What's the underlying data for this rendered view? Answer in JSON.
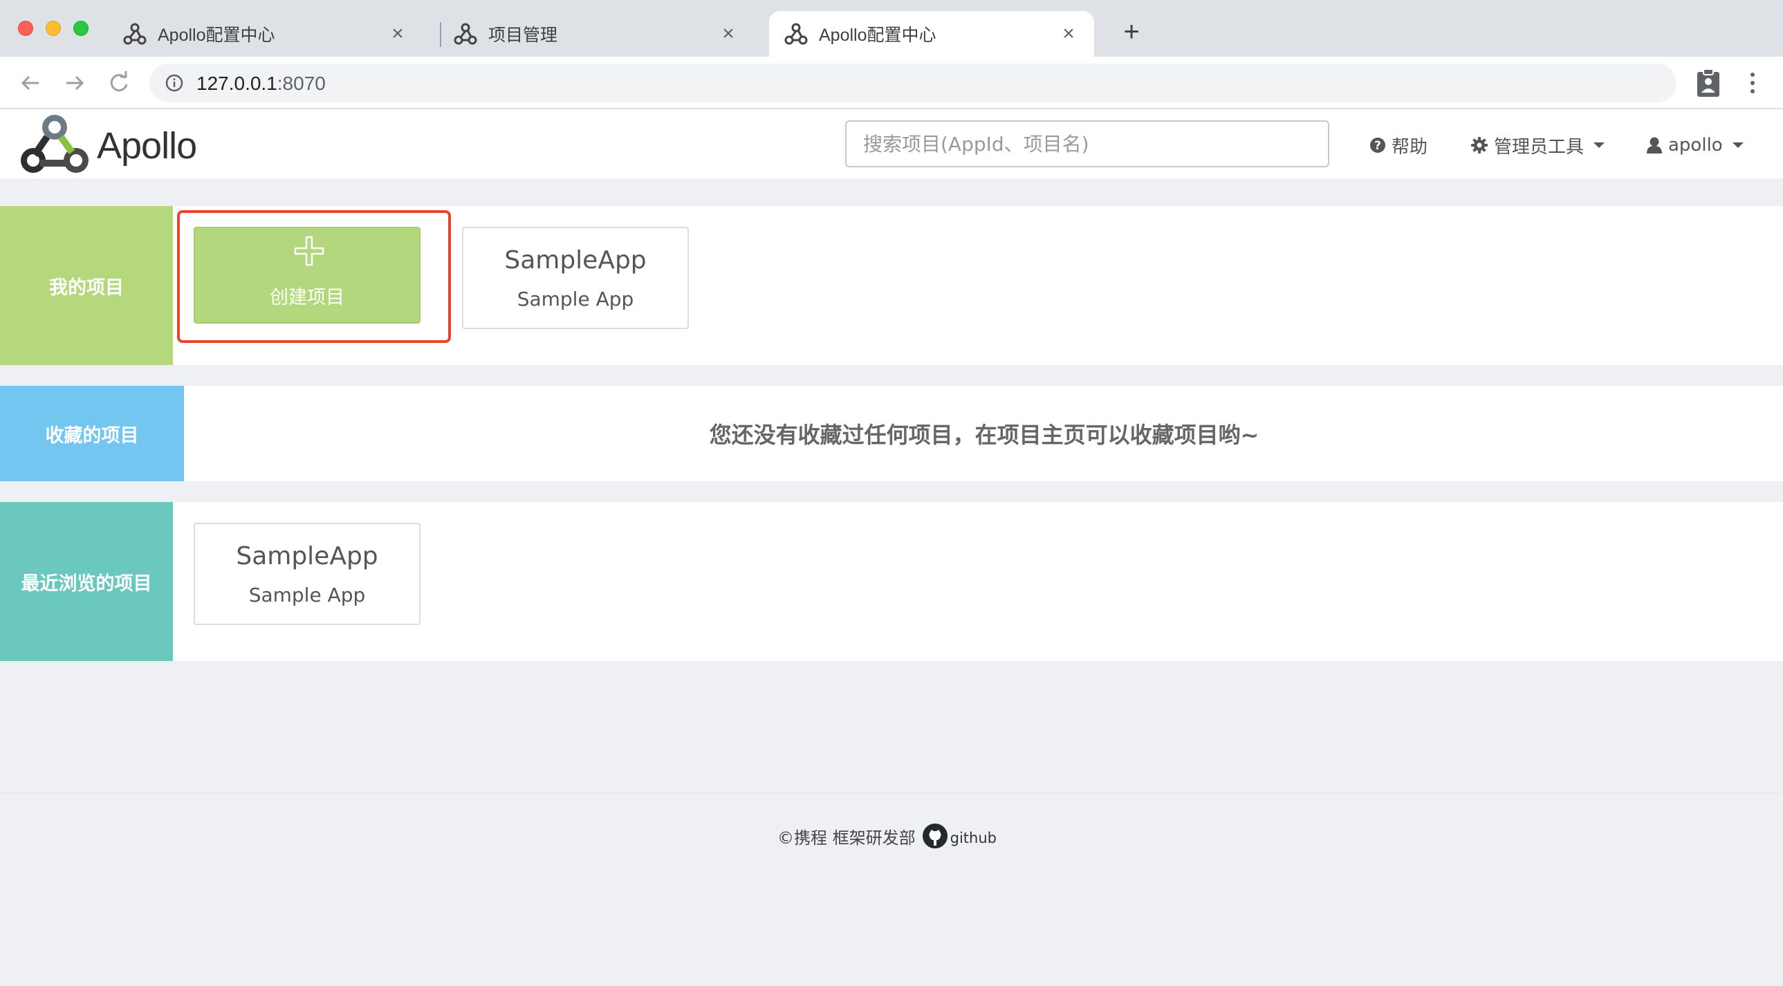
{
  "browser": {
    "tabs": [
      {
        "title": "Apollo配置中心",
        "active": false
      },
      {
        "title": "项目管理",
        "active": false
      },
      {
        "title": "Apollo配置中心",
        "active": true
      }
    ],
    "new_tab": "+",
    "url_host": "127.0.0.1",
    "url_port": ":8070",
    "close_glyph": "×"
  },
  "header": {
    "logo_text": "Apollo",
    "search_placeholder": "搜索项目(AppId、项目名)",
    "help_label": "帮助",
    "admin_tools_label": "管理员工具",
    "user_label": "apollo"
  },
  "my_projects": {
    "label": "我的项目",
    "color": "#b5d87c",
    "create_label": "创建项目",
    "apps": [
      {
        "app_id": "SampleApp",
        "name": "Sample App"
      }
    ]
  },
  "favorites": {
    "label": "收藏的项目",
    "color": "#72c6ef",
    "empty_message": "您还没有收藏过任何项目，在项目主页可以收藏项目哟~"
  },
  "recent": {
    "label": "最近浏览的项目",
    "color": "#6ac8be",
    "apps": [
      {
        "app_id": "SampleApp",
        "name": "Sample App"
      }
    ]
  },
  "footer": {
    "copyright": "©携程 框架研发部",
    "github_label": "github"
  },
  "colors": {
    "highlight": "#e8452c",
    "page_bg": "#eef0f4"
  }
}
